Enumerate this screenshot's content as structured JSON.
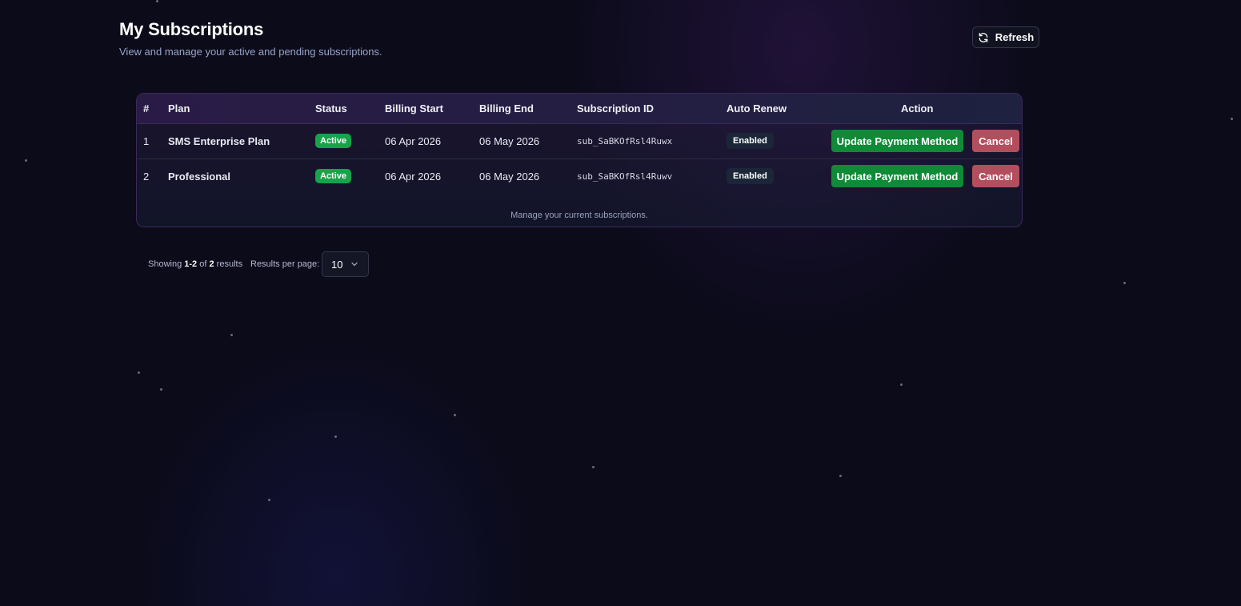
{
  "header": {
    "title": "My Subscriptions",
    "subtitle": "View and manage your active and pending subscriptions.",
    "refresh_label": "Refresh",
    "refresh_icon": "refresh-icon"
  },
  "table": {
    "columns": [
      "#",
      "Plan",
      "Status",
      "Billing Start",
      "Billing End",
      "Subscription ID",
      "Auto Renew",
      "Action"
    ],
    "rows": [
      {
        "index": "1",
        "plan": "SMS Enterprise Plan",
        "status": "Active",
        "billing_start": "06 Apr 2026",
        "billing_end": "06 May 2026",
        "subscription_id": "sub_SaBKOfRsl4Ruwx",
        "auto_renew": "Enabled",
        "update_label": "Update Payment Method",
        "cancel_label": "Cancel"
      },
      {
        "index": "2",
        "plan": "Professional",
        "status": "Active",
        "billing_start": "06 Apr 2026",
        "billing_end": "06 May 2026",
        "subscription_id": "sub_SaBKOfRsl4Ruwv",
        "auto_renew": "Enabled",
        "update_label": "Update Payment Method",
        "cancel_label": "Cancel"
      }
    ],
    "footer": "Manage your current subscriptions."
  },
  "pagination": {
    "showing_prefix": "Showing",
    "range": "1-2",
    "of": "of",
    "total": "2",
    "results": "results",
    "per_page_label": "Results per page:",
    "per_page_value": "10"
  },
  "colors": {
    "background": "#0b0b1a",
    "active_badge": "#16a34a",
    "update_button": "#0f8a37",
    "cancel_button": "#b34e5e",
    "enabled_badge": "#1b2638"
  }
}
